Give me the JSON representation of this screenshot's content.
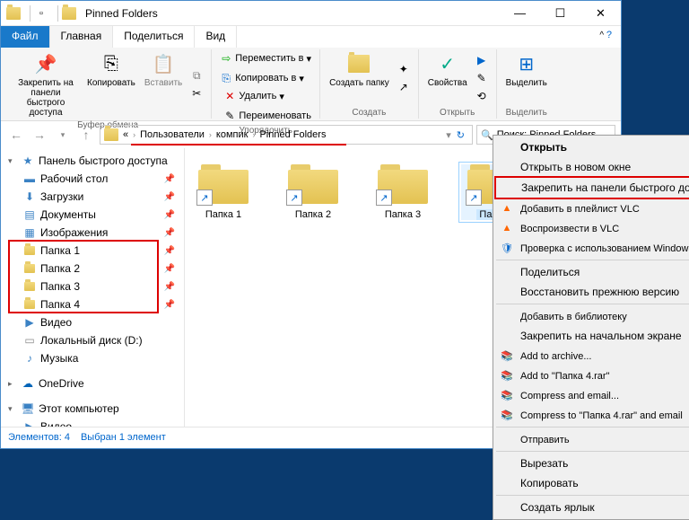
{
  "titlebar": {
    "title": "Pinned Folders"
  },
  "win_buttons": {
    "min": "—",
    "max": "☐",
    "close": "✕"
  },
  "tabs": {
    "file": "Файл",
    "home": "Главная",
    "share": "Поделиться",
    "view": "Вид"
  },
  "ribbon": {
    "clipboard": {
      "label": "Буфер обмена",
      "pin": "Закрепить на панели быстрого доступа",
      "copy": "Копировать",
      "paste": "Вставить"
    },
    "organize": {
      "label": "Упорядочить",
      "move": "Переместить в",
      "copy_to": "Копировать в",
      "delete": "Удалить",
      "rename": "Переименовать"
    },
    "new": {
      "label": "Создать",
      "folder": "Создать папку"
    },
    "open": {
      "label": "Открыть",
      "props": "Свойства"
    },
    "select": {
      "label": "Выделить",
      "btn": "Выделить"
    }
  },
  "breadcrumb": {
    "b1": "«",
    "b2": "Пользователи",
    "b3": "компик",
    "b4": "Pinned Folders"
  },
  "search": {
    "placeholder": "Поиск: Pinned Folders"
  },
  "sidebar": {
    "quick": "Панель быстрого доступа",
    "desktop": "Рабочий стол",
    "downloads": "Загрузки",
    "documents": "Документы",
    "pictures": "Изображения",
    "f1": "Папка 1",
    "f2": "Папка 2",
    "f3": "Папка 3",
    "f4": "Папка 4",
    "video": "Видео",
    "disk_d": "Локальный диск (D:)",
    "music": "Музыка",
    "onedrive": "OneDrive",
    "thispc": "Этот компьютер",
    "video2": "Видео"
  },
  "folders": {
    "f1": "Папка 1",
    "f2": "Папка 2",
    "f3": "Папка 3",
    "f4": "Пап..."
  },
  "context_menu": {
    "open": "Открыть",
    "open_new": "Открыть в новом окне",
    "pin_quick": "Закрепить на панели быстрого доступа",
    "vlc_playlist": "Добавить в плейлист VLC",
    "vlc_play": "Воспроизвести в VLC",
    "defender": "Проверка с использованием Windows Defe",
    "share": "Поделиться",
    "restore": "Восстановить прежнюю версию",
    "library": "Добавить в библиотеку",
    "pin_start": "Закрепить на начальном экране",
    "add_archive": "Add to archive...",
    "add_rar": "Add to \"Папка 4.rar\"",
    "compress_email": "Compress and email...",
    "compress_rar_email": "Compress to \"Папка 4.rar\" and email",
    "send": "Отправить",
    "cut": "Вырезать",
    "copy": "Копировать",
    "shortcut": "Создать ярлык"
  },
  "status": {
    "count": "Элементов: 4",
    "selected": "Выбран 1 элемент"
  }
}
